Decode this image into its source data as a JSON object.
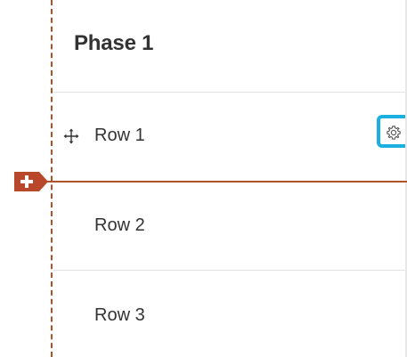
{
  "phase": {
    "title": "Phase 1"
  },
  "rows": [
    {
      "label": "Row 1"
    },
    {
      "label": "Row 2"
    },
    {
      "label": "Row 3"
    }
  ],
  "icons": {
    "move": "move-icon",
    "settings": "gear-icon",
    "insert": "plus-icon"
  },
  "colors": {
    "guide": "#b0532a",
    "insert_button": "#b9472b",
    "focus_ring": "#1bb0e0",
    "text": "#333333",
    "divider": "#e2e2e2"
  }
}
